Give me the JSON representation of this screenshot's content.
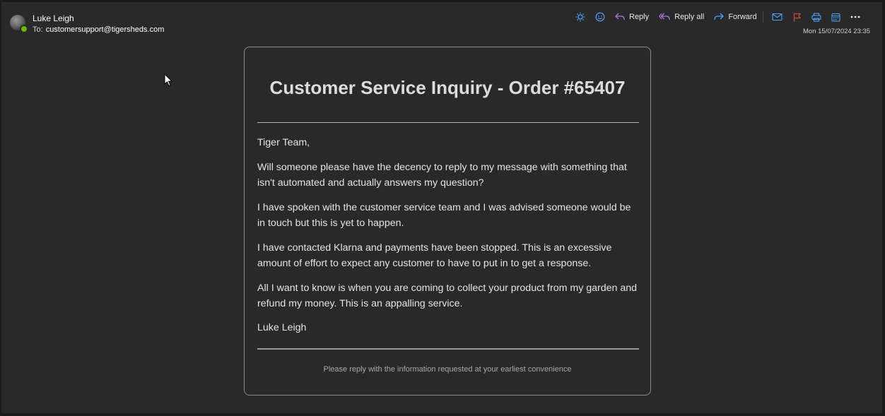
{
  "header": {
    "sender_name": "Luke Leigh",
    "to_label": "To:",
    "to_address": "customersupport@tigersheds.com",
    "timestamp": "Mon 15/07/2024 23:35",
    "presence_color": "#6bb700"
  },
  "toolbar": {
    "reply_label": "Reply",
    "reply_all_label": "Reply all",
    "forward_label": "Forward",
    "icons": [
      "sun-icon",
      "emoji-icon",
      "reply-icon",
      "reply-all-icon",
      "forward-icon",
      "mail-icon",
      "flag-icon",
      "print-icon",
      "calendar-icon",
      "more-icon"
    ]
  },
  "email": {
    "title": "Customer Service Inquiry - Order #65407",
    "greeting": "Tiger Team,",
    "paragraphs": [
      "Will someone please have the decency to reply to my message with something that isn't automated and actually answers my question?",
      "I have spoken with the customer service team and I was advised someone would be in touch but this is yet to happen.",
      "I have contacted Klarna and payments have been stopped. This is an excessive amount of effort to expect any customer to have to put in to get a response.",
      "All I want to know is when you are coming to collect your product from my garden and refund my money. This is an appalling service."
    ],
    "signature": "Luke Leigh",
    "footer": "Please reply with the information requested at your earliest convenience"
  }
}
